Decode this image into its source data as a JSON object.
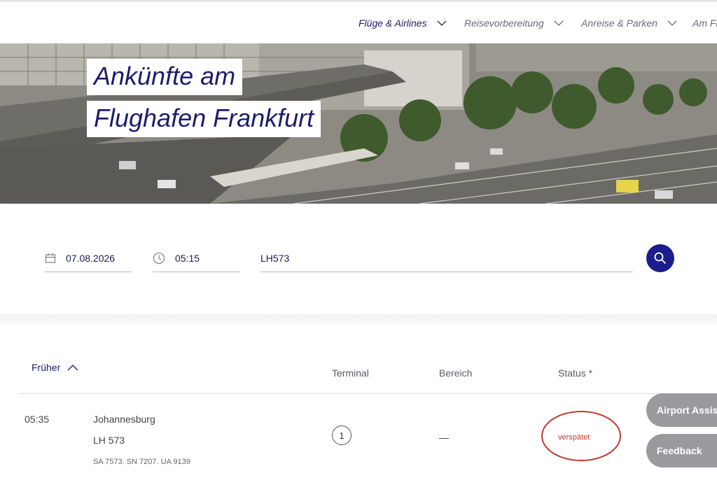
{
  "nav": {
    "items": [
      {
        "label": "Flüge & Airlines",
        "active": true
      },
      {
        "label": "Reisevorbereitung",
        "active": false
      },
      {
        "label": "Anreise & Parken",
        "active": false
      },
      {
        "label": "Am Flughafen",
        "active": false
      }
    ]
  },
  "hero": {
    "title_line1": "Ankünfte am",
    "title_line2": "Flughafen Frankfurt"
  },
  "search": {
    "date_value": "07.08.2026",
    "time_value": "05:15",
    "flight_value": "LH573",
    "button_icon": "search-icon"
  },
  "results": {
    "earlier_label": "Früher",
    "columns": {
      "terminal": "Terminal",
      "area": "Bereich",
      "status": "Status *"
    },
    "rows": [
      {
        "time": "05:35",
        "city": "Johannesburg",
        "flight": "LH 573",
        "codeshares": "SA 7573. SN 7207. UA 9139",
        "terminal": "1",
        "area": "—",
        "status": "verspätet"
      }
    ]
  },
  "floating": {
    "assistant": "Airport Assistant",
    "feedback": "Feedback"
  },
  "colors": {
    "brand_navy": "#1c1c8c",
    "status_delayed": "#c0392b",
    "floating_button": "#9a9a9e"
  }
}
